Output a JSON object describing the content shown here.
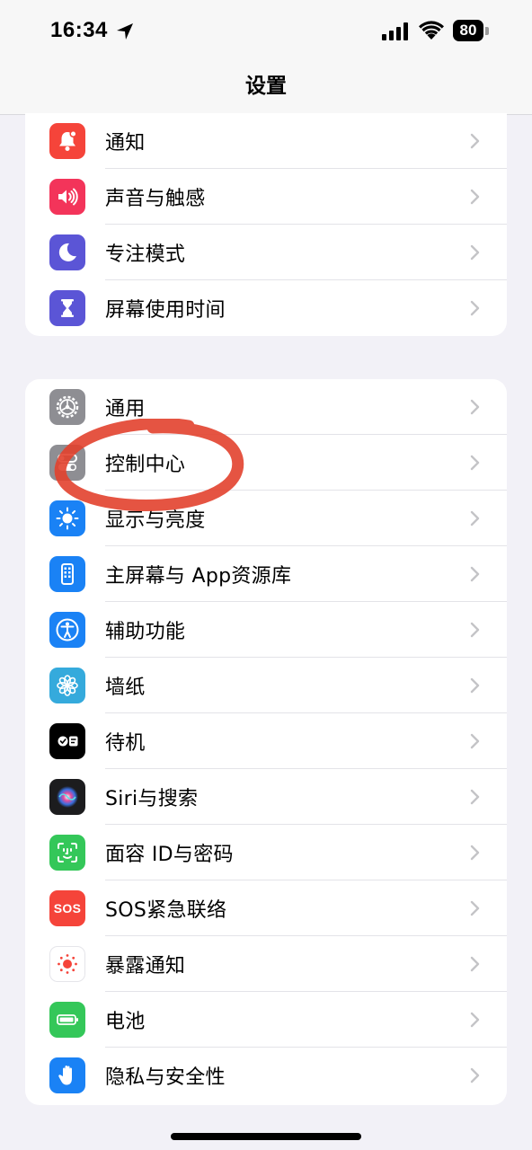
{
  "status_bar": {
    "time": "16:34",
    "battery": "80"
  },
  "nav": {
    "title": "设置"
  },
  "groups": [
    {
      "items": [
        {
          "label": "通知",
          "icon": "bell-icon",
          "color": "#f5443a"
        },
        {
          "label": "声音与触感",
          "icon": "speaker-icon",
          "color": "#f3345a"
        },
        {
          "label": "专注模式",
          "icon": "moon-icon",
          "color": "#5b55d6"
        },
        {
          "label": "屏幕使用时间",
          "icon": "hourglass-icon",
          "color": "#5b55d6"
        }
      ]
    },
    {
      "items": [
        {
          "label": "通用",
          "icon": "gear-icon",
          "color": "#8e8e93"
        },
        {
          "label": "控制中心",
          "icon": "switches-icon",
          "color": "#8e8e93"
        },
        {
          "label": "显示与亮度",
          "icon": "sun-icon",
          "color": "#1a82f5"
        },
        {
          "label": "主屏幕与 App资源库",
          "icon": "home-screen-icon",
          "color": "#1a82f5"
        },
        {
          "label": "辅助功能",
          "icon": "accessibility-icon",
          "color": "#1a82f5"
        },
        {
          "label": "墙纸",
          "icon": "flower-icon",
          "color": "#35aadc"
        },
        {
          "label": "待机",
          "icon": "standby-icon",
          "color": "#000000"
        },
        {
          "label": "Siri与搜索",
          "icon": "siri-icon",
          "color": "#1c1c1e"
        },
        {
          "label": "面容 ID与密码",
          "icon": "faceid-icon",
          "color": "#34c759"
        },
        {
          "label": "SOS紧急联络",
          "icon": "sos-icon",
          "color": "#f5443a"
        },
        {
          "label": "暴露通知",
          "icon": "exposure-icon",
          "color": "#ffffff"
        },
        {
          "label": "电池",
          "icon": "battery-icon",
          "color": "#34c759"
        },
        {
          "label": "隐私与安全性",
          "icon": "hand-icon",
          "color": "#1a82f5"
        }
      ]
    }
  ],
  "sos_text": "SOS",
  "annotation_color": "#e2412d"
}
